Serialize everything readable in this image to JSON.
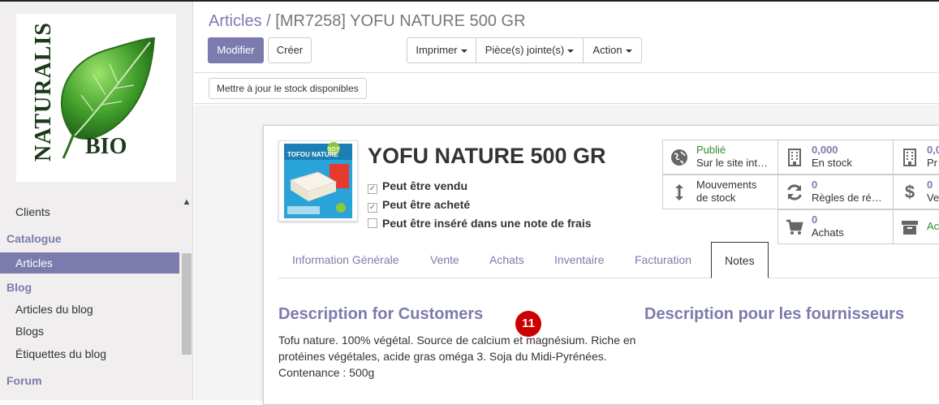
{
  "sidebar": {
    "logo_text_1": "NATURALIS",
    "logo_text_2": "BIO",
    "items": [
      {
        "label": "Clients"
      },
      {
        "section": "Catalogue"
      },
      {
        "label": "Articles",
        "active": true
      },
      {
        "section": "Blog"
      },
      {
        "label": "Articles du blog"
      },
      {
        "label": "Blogs"
      },
      {
        "label": "Étiquettes du blog"
      },
      {
        "section": "Forum"
      }
    ]
  },
  "breadcrumb": {
    "parent": "Articles",
    "separator": "/",
    "current": "[MR7258] YOFU NATURE 500 GR"
  },
  "toolbar": {
    "edit_label": "Modifier",
    "create_label": "Créer",
    "print_label": "Imprimer",
    "attachments_label": "Pièce(s) jointe(s)",
    "action_label": "Action"
  },
  "statusbar": {
    "update_stock_label": "Mettre à jour le stock disponibles"
  },
  "product": {
    "image_brand": "SOY",
    "image_label": "TOFOU NATURE",
    "title": "YOFU NATURE 500 GR",
    "checkboxes": [
      {
        "label": "Peut être vendu",
        "checked": true
      },
      {
        "label": "Peut être acheté",
        "checked": true
      },
      {
        "label": "Peut être inséré dans une note de frais",
        "checked": false
      }
    ]
  },
  "smart_buttons": [
    {
      "icon": "globe-icon",
      "line1": "Publié",
      "line2": "Sur le site int…"
    },
    {
      "icon": "building-icon",
      "line1": "0,000",
      "line2": "En stock"
    },
    {
      "icon": "building-icon",
      "line1": "0,0",
      "line2": "Pr"
    },
    {
      "icon": "arrows-vertical-icon",
      "line1": "Mouvements",
      "line2": "de stock"
    },
    {
      "icon": "refresh-icon",
      "line1": "0",
      "line2": "Règles de ré…"
    },
    {
      "icon": "dollar-icon",
      "line1": "0",
      "line2": "Ve"
    },
    {
      "icon": "cart-icon",
      "line1": "0",
      "line2": "Achats"
    },
    {
      "icon": "archive-icon",
      "line1": "Ac",
      "line2": ""
    }
  ],
  "tabs": [
    {
      "label": "Information Générale"
    },
    {
      "label": "Vente"
    },
    {
      "label": "Achats"
    },
    {
      "label": "Inventaire"
    },
    {
      "label": "Facturation"
    },
    {
      "label": "Notes",
      "active": true
    }
  ],
  "notes": {
    "customer_heading": "Description for Customers",
    "supplier_heading": "Description pour les fournisseurs",
    "customer_text_1": "Tofu nature. 100% végétal. Source de calcium et magnésium. Riche en",
    "customer_text_2": "protéines végétales, acide gras oméga 3. Soja du Midi-Pyrénées.",
    "customer_text_3": "Contenance : 500g"
  },
  "badge": {
    "value": "11"
  },
  "colors": {
    "accent": "#7c7bad",
    "published": "#2e8b2e",
    "badge": "#cc0000"
  }
}
